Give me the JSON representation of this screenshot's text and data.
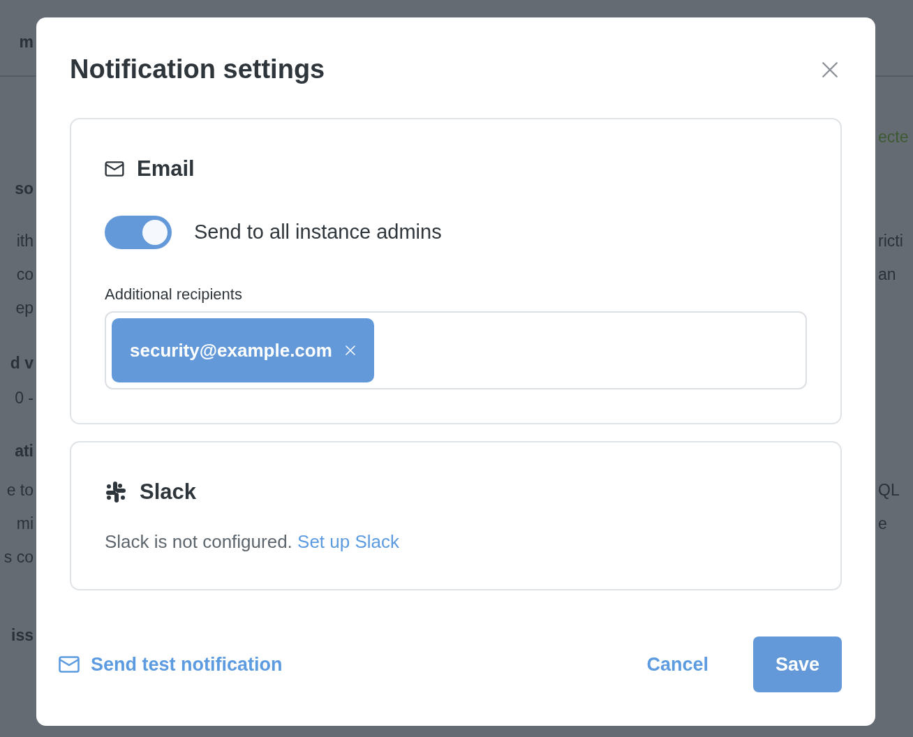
{
  "background": {
    "left_fragments": [
      {
        "text": "m",
        "kind": "heading"
      },
      {
        "text": "so",
        "kind": "heading"
      },
      {
        "text": "ith",
        "kind": "text"
      },
      {
        "text": "co",
        "kind": "text"
      },
      {
        "text": "ep",
        "kind": "text"
      },
      {
        "text": "d v",
        "kind": "heading"
      },
      {
        "text": "0 -",
        "kind": "text"
      },
      {
        "text": "ati",
        "kind": "heading"
      },
      {
        "text": "e to",
        "kind": "text"
      },
      {
        "text": "mi",
        "kind": "text"
      },
      {
        "text": "s co",
        "kind": "text"
      },
      {
        "text": "iss",
        "kind": "heading"
      }
    ],
    "right_fragments": [
      {
        "text": "ecte",
        "kind": "status"
      },
      {
        "text": "ricti",
        "kind": "text"
      },
      {
        "text": "an",
        "kind": "text"
      },
      {
        "text": "QL",
        "kind": "text"
      },
      {
        "text": "e",
        "kind": "text"
      }
    ]
  },
  "modal": {
    "title": "Notification settings",
    "email": {
      "title": "Email",
      "toggle": {
        "label": "Send to all instance admins",
        "on": true
      },
      "recipients": {
        "label": "Additional recipients",
        "chips": [
          {
            "text": "security@example.com"
          }
        ]
      }
    },
    "slack": {
      "title": "Slack",
      "text": "Slack is not configured.",
      "link": "Set up Slack"
    },
    "footer": {
      "test_link": "Send test notification",
      "cancel": "Cancel",
      "save": "Save"
    }
  }
}
